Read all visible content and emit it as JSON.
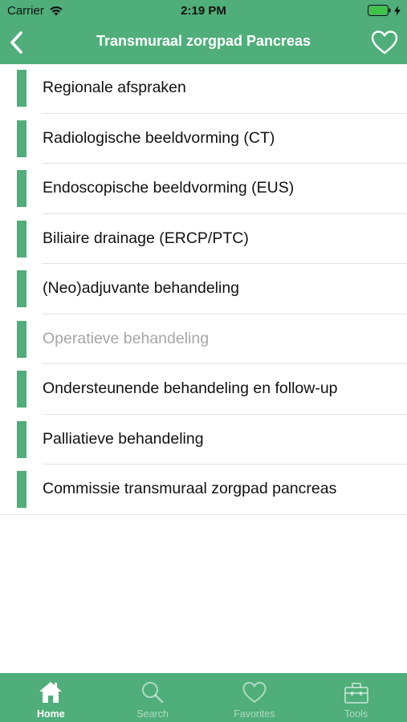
{
  "status_bar": {
    "carrier": "Carrier",
    "time": "2:19 PM",
    "icons": [
      "wifi-icon",
      "battery-icon",
      "charging-bolt-icon"
    ]
  },
  "nav": {
    "title": "Transmuraal zorgpad Pancreas",
    "back_icon": "chevron-left-icon",
    "favorite_icon": "heart-outline-icon"
  },
  "list": {
    "items": [
      {
        "label": "Regionale afspraken",
        "enabled": true
      },
      {
        "label": "Radiologische beeldvorming (CT)",
        "enabled": true
      },
      {
        "label": "Endoscopische beeldvorming (EUS)",
        "enabled": true
      },
      {
        "label": "Biliaire drainage (ERCP/PTC)",
        "enabled": true
      },
      {
        "label": "(Neo)adjuvante behandeling",
        "enabled": true
      },
      {
        "label": "Operatieve behandeling",
        "enabled": false
      },
      {
        "label": "Ondersteunende behandeling en follow-up",
        "enabled": true
      },
      {
        "label": "Palliatieve behandeling",
        "enabled": true
      },
      {
        "label": "Commissie transmuraal zorgpad pancreas",
        "enabled": true
      }
    ]
  },
  "tabbar": {
    "tabs": [
      {
        "label": "Home",
        "icon": "home-icon",
        "active": true
      },
      {
        "label": "Search",
        "icon": "search-icon",
        "active": false
      },
      {
        "label": "Favorites",
        "icon": "heart-icon",
        "active": false
      },
      {
        "label": "Tools",
        "icon": "toolbox-icon",
        "active": false
      }
    ]
  },
  "colors": {
    "accent": "#4fae79",
    "text": "#111111",
    "disabled_text": "#a6a6a6",
    "separator": "#e2e2e2"
  }
}
